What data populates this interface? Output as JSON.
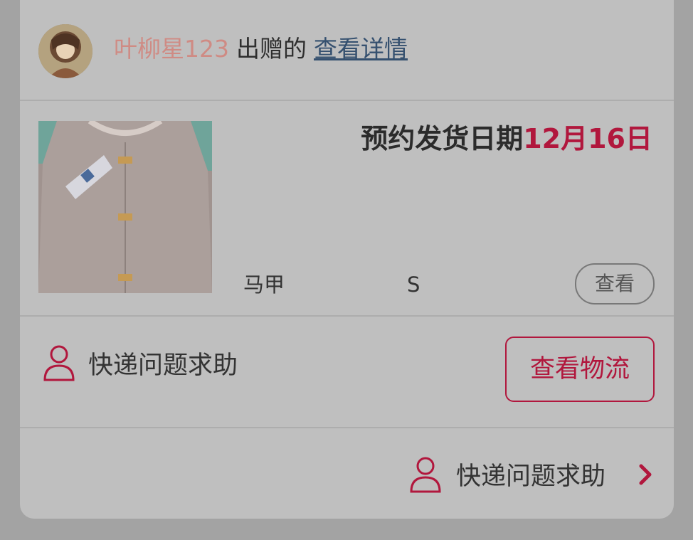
{
  "header": {
    "giver_name": "叶柳星123",
    "action_text": "出赠的",
    "detail_link": "查看详情"
  },
  "product": {
    "ship_date_label": "预约发货日期",
    "ship_date_value": "12月16日",
    "name": "马甲",
    "size": "S",
    "view_button": "查看"
  },
  "help_row": {
    "help_label": "快递问题求助",
    "logistics_button": "查看物流"
  },
  "footer": {
    "help_label": "快递问题求助"
  },
  "colors": {
    "accent": "#b1173d",
    "link": "#35506f",
    "giver_name": "#cf8b84"
  },
  "icons": [
    "avatar",
    "person-icon",
    "chevron-right-icon"
  ]
}
